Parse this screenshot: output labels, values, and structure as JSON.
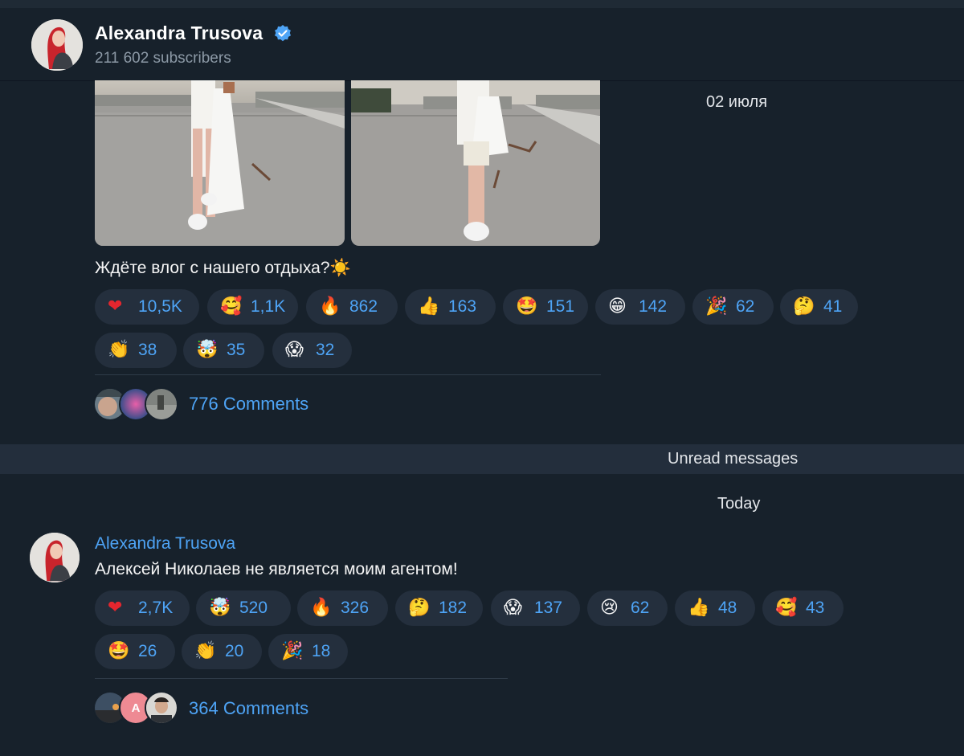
{
  "channel": {
    "name": "Alexandra Trusova",
    "subscribers": "211 602 subscribers"
  },
  "post1": {
    "date": "02 июля",
    "text": "Ждёте влог с нашего отдыха?☀️",
    "reactions": [
      {
        "emoji": "❤",
        "count": "10,5K",
        "icon": "red-heart-icon"
      },
      {
        "emoji": "🥰",
        "count": "1,1K",
        "icon": "smiling-face-with-hearts-icon"
      },
      {
        "emoji": "🔥",
        "count": "862",
        "icon": "fire-icon"
      },
      {
        "emoji": "👍",
        "count": "163",
        "icon": "thumbs-up-icon"
      },
      {
        "emoji": "🤩",
        "count": "151",
        "icon": "star-struck-icon"
      },
      {
        "emoji": "😁",
        "count": "142",
        "icon": "beaming-face-icon"
      },
      {
        "emoji": "🎉",
        "count": "62",
        "icon": "party-popper-icon"
      },
      {
        "emoji": "🤔",
        "count": "41",
        "icon": "thinking-face-icon"
      },
      {
        "emoji": "👏",
        "count": "38",
        "icon": "clapping-hands-icon"
      },
      {
        "emoji": "🤯",
        "count": "35",
        "icon": "exploding-head-icon"
      },
      {
        "emoji": "😱",
        "count": "32",
        "icon": "screaming-face-icon"
      }
    ],
    "comments": "776 Comments"
  },
  "unread_label": "Unread messages",
  "today_label": "Today",
  "post2": {
    "sender": "Alexandra Trusova",
    "text": "Алексей Николаев не является моим агентом!",
    "reactions": [
      {
        "emoji": "❤",
        "count": "2,7K",
        "icon": "red-heart-icon"
      },
      {
        "emoji": "🤯",
        "count": "520",
        "icon": "exploding-head-icon"
      },
      {
        "emoji": "🔥",
        "count": "326",
        "icon": "fire-icon"
      },
      {
        "emoji": "🤔",
        "count": "182",
        "icon": "thinking-face-icon"
      },
      {
        "emoji": "😱",
        "count": "137",
        "icon": "screaming-face-icon"
      },
      {
        "emoji": "😢",
        "count": "62",
        "icon": "crying-face-icon"
      },
      {
        "emoji": "👍",
        "count": "48",
        "icon": "thumbs-up-icon"
      },
      {
        "emoji": "🥰",
        "count": "43",
        "icon": "smiling-face-with-hearts-icon"
      },
      {
        "emoji": "🤩",
        "count": "26",
        "icon": "star-struck-icon"
      },
      {
        "emoji": "👏",
        "count": "20",
        "icon": "clapping-hands-icon"
      },
      {
        "emoji": "🎉",
        "count": "18",
        "icon": "party-popper-icon"
      }
    ],
    "comments": "364 Comments",
    "commenter_initial": "A"
  },
  "colors": {
    "background": "#17212b",
    "chip": "#242f3d",
    "accent": "#4ea4f6",
    "unread_bar": "#232e3c"
  }
}
